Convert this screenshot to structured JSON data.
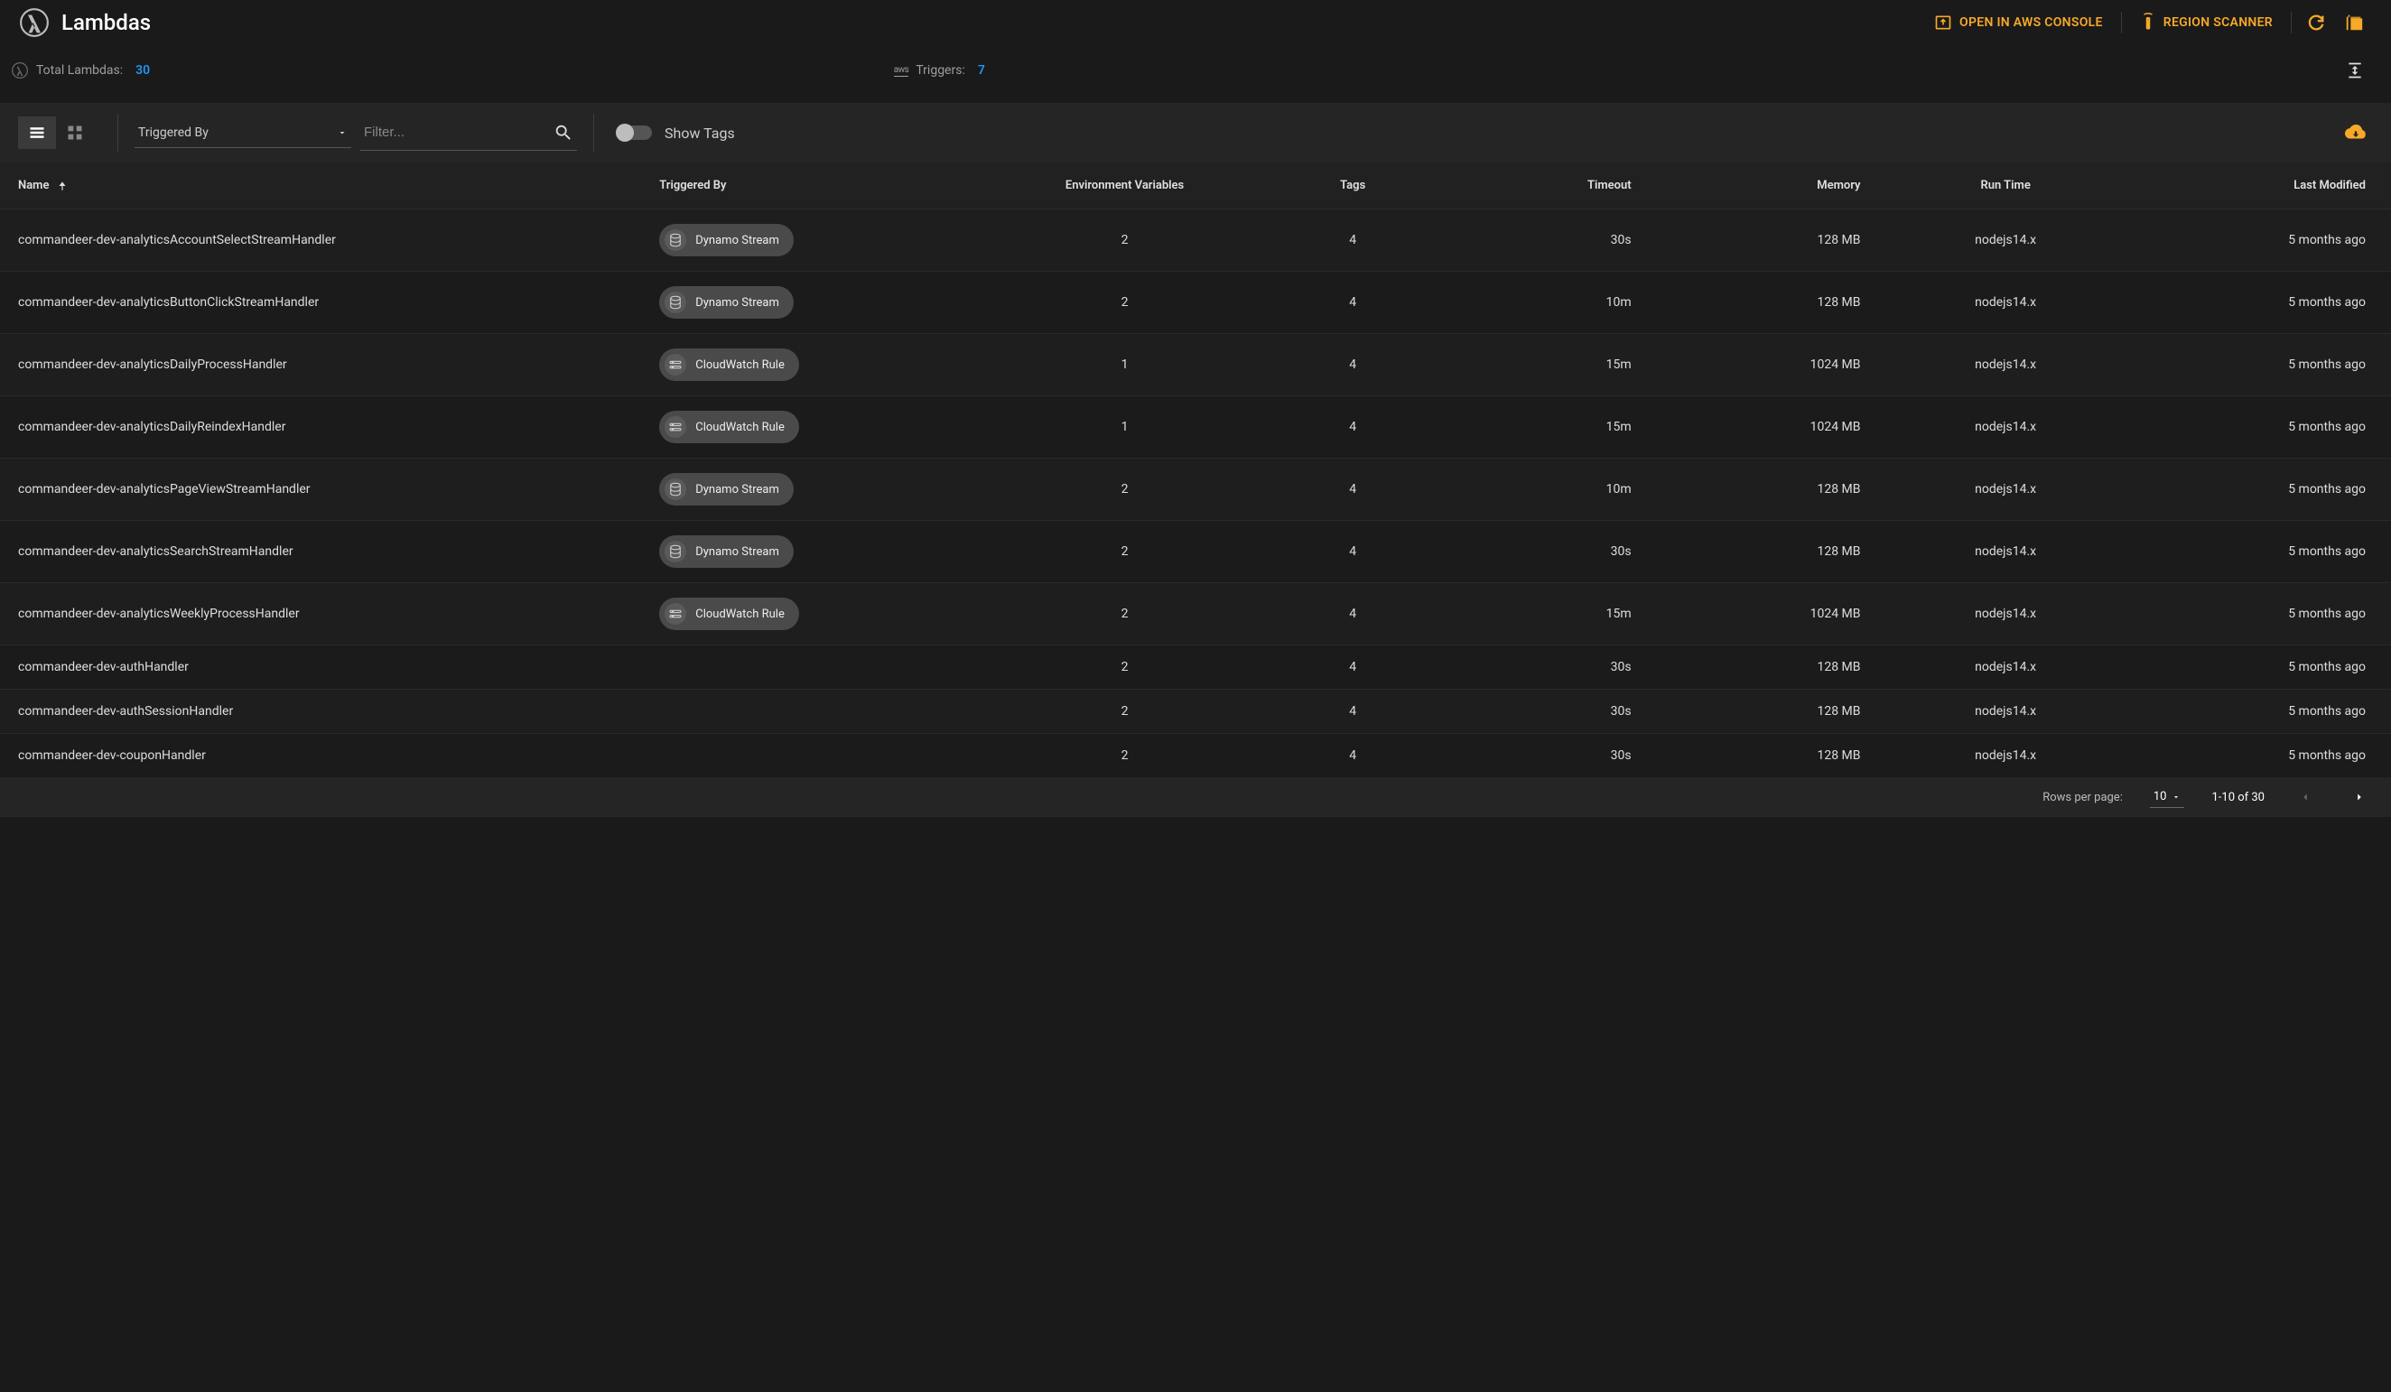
{
  "header": {
    "title": "Lambdas",
    "open_console": "OPEN IN AWS CONSOLE",
    "region_scanner": "REGION SCANNER"
  },
  "stats": {
    "total_label": "Total Lambdas:",
    "total_value": "30",
    "triggers_label": "Triggers:",
    "triggers_value": "7"
  },
  "toolbar": {
    "triggered_by_label": "Triggered By",
    "filter_placeholder": "Filter...",
    "show_tags_label": "Show Tags"
  },
  "columns": {
    "name": "Name",
    "triggered_by": "Triggered By",
    "env": "Environment Variables",
    "tags": "Tags",
    "timeout": "Timeout",
    "memory": "Memory",
    "runtime": "Run Time",
    "modified": "Last Modified"
  },
  "rows": [
    {
      "name": "commandeer-dev-analyticsAccountSelectStreamHandler",
      "trigger": "Dynamo Stream",
      "trigger_icon": "db",
      "env": "2",
      "tags": "4",
      "timeout": "30s",
      "memory": "128 MB",
      "runtime": "nodejs14.x",
      "modified": "5 months ago"
    },
    {
      "name": "commandeer-dev-analyticsButtonClickStreamHandler",
      "trigger": "Dynamo Stream",
      "trigger_icon": "db",
      "env": "2",
      "tags": "4",
      "timeout": "10m",
      "memory": "128 MB",
      "runtime": "nodejs14.x",
      "modified": "5 months ago"
    },
    {
      "name": "commandeer-dev-analyticsDailyProcessHandler",
      "trigger": "CloudWatch Rule",
      "trigger_icon": "cw",
      "env": "1",
      "tags": "4",
      "timeout": "15m",
      "memory": "1024 MB",
      "runtime": "nodejs14.x",
      "modified": "5 months ago"
    },
    {
      "name": "commandeer-dev-analyticsDailyReindexHandler",
      "trigger": "CloudWatch Rule",
      "trigger_icon": "cw",
      "env": "1",
      "tags": "4",
      "timeout": "15m",
      "memory": "1024 MB",
      "runtime": "nodejs14.x",
      "modified": "5 months ago"
    },
    {
      "name": "commandeer-dev-analyticsPageViewStreamHandler",
      "trigger": "Dynamo Stream",
      "trigger_icon": "db",
      "env": "2",
      "tags": "4",
      "timeout": "10m",
      "memory": "128 MB",
      "runtime": "nodejs14.x",
      "modified": "5 months ago"
    },
    {
      "name": "commandeer-dev-analyticsSearchStreamHandler",
      "trigger": "Dynamo Stream",
      "trigger_icon": "db",
      "env": "2",
      "tags": "4",
      "timeout": "30s",
      "memory": "128 MB",
      "runtime": "nodejs14.x",
      "modified": "5 months ago"
    },
    {
      "name": "commandeer-dev-analyticsWeeklyProcessHandler",
      "trigger": "CloudWatch Rule",
      "trigger_icon": "cw",
      "env": "2",
      "tags": "4",
      "timeout": "15m",
      "memory": "1024 MB",
      "runtime": "nodejs14.x",
      "modified": "5 months ago"
    },
    {
      "name": "commandeer-dev-authHandler",
      "trigger": "",
      "trigger_icon": "",
      "env": "2",
      "tags": "4",
      "timeout": "30s",
      "memory": "128 MB",
      "runtime": "nodejs14.x",
      "modified": "5 months ago"
    },
    {
      "name": "commandeer-dev-authSessionHandler",
      "trigger": "",
      "trigger_icon": "",
      "env": "2",
      "tags": "4",
      "timeout": "30s",
      "memory": "128 MB",
      "runtime": "nodejs14.x",
      "modified": "5 months ago"
    },
    {
      "name": "commandeer-dev-couponHandler",
      "trigger": "",
      "trigger_icon": "",
      "env": "2",
      "tags": "4",
      "timeout": "30s",
      "memory": "128 MB",
      "runtime": "nodejs14.x",
      "modified": "5 months ago"
    }
  ],
  "footer": {
    "rows_per_page_label": "Rows per page:",
    "rows_per_page_value": "10",
    "range": "1-10 of 30"
  }
}
